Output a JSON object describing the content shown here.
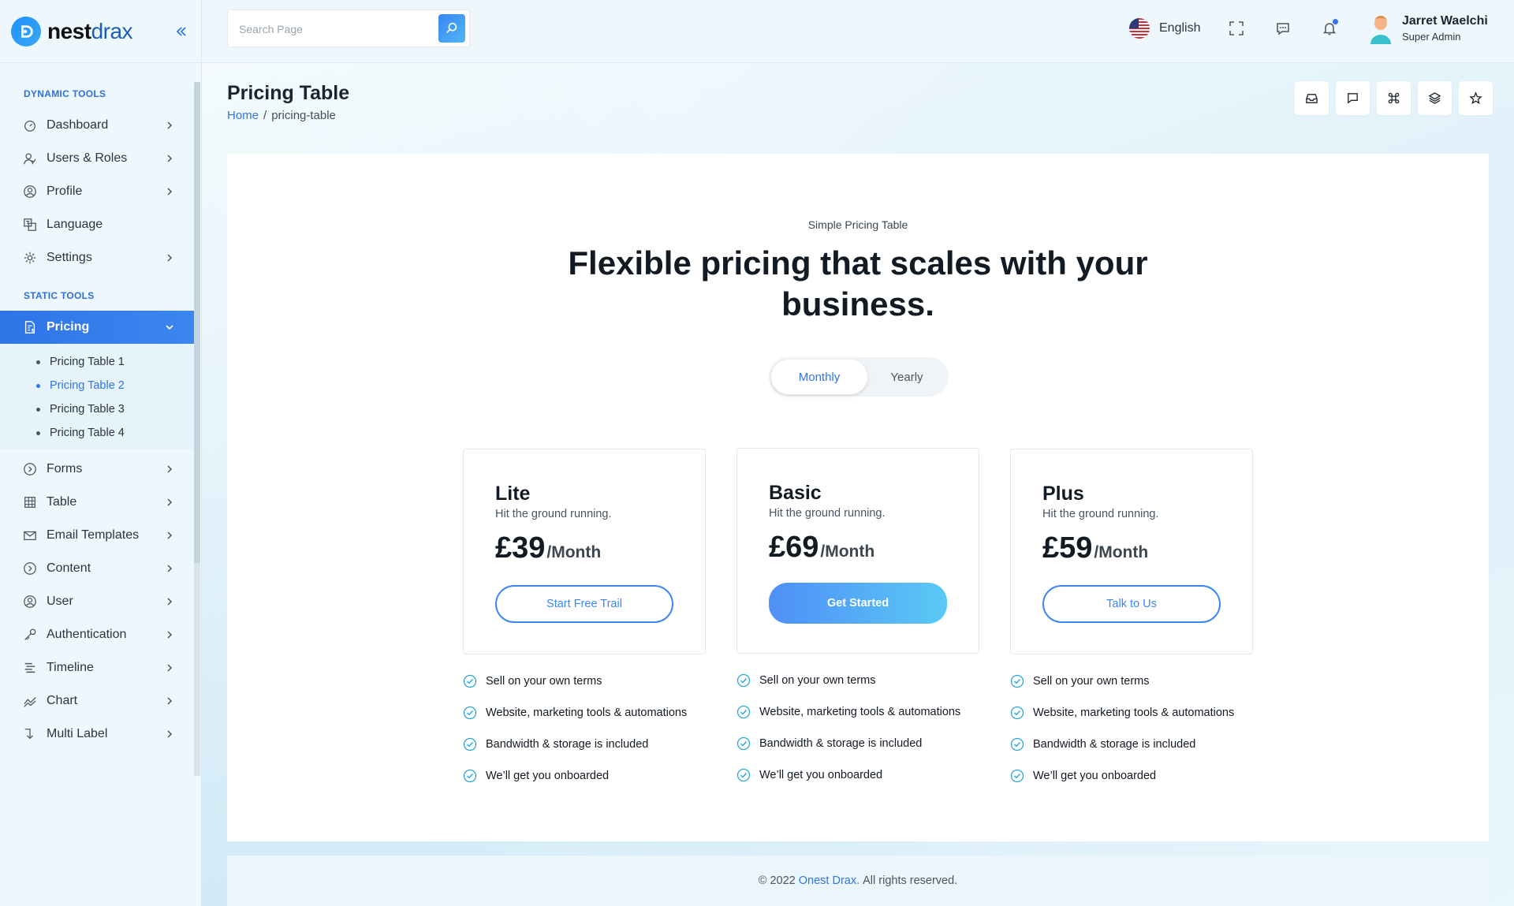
{
  "brand": {
    "part1": "nest",
    "part2": "drax"
  },
  "search": {
    "placeholder": "Search Page"
  },
  "header": {
    "language": "English",
    "user": {
      "name": "Jarret Waelchi",
      "role": "Super Admin"
    }
  },
  "sidebar": {
    "section_dynamic": "DYNAMIC TOOLS",
    "section_static": "STATIC TOOLS",
    "dynamic_items": [
      {
        "label": "Dashboard",
        "icon": "gauge-icon"
      },
      {
        "label": "Users & Roles",
        "icon": "users-icon"
      },
      {
        "label": "Profile",
        "icon": "user-circle-icon"
      },
      {
        "label": "Language",
        "icon": "translate-icon"
      },
      {
        "label": "Settings",
        "icon": "gear-icon"
      }
    ],
    "active_item": {
      "label": "Pricing",
      "icon": "invoice-icon"
    },
    "sub_items": [
      {
        "label": "Pricing Table 1"
      },
      {
        "label": "Pricing Table 2"
      },
      {
        "label": "Pricing Table 3"
      },
      {
        "label": "Pricing Table 4"
      }
    ],
    "static_items": [
      {
        "label": "Forms",
        "icon": "circle-arrow-icon"
      },
      {
        "label": "Table",
        "icon": "grid-icon"
      },
      {
        "label": "Email Templates",
        "icon": "mail-icon"
      },
      {
        "label": "Content",
        "icon": "circle-arrow-icon"
      },
      {
        "label": "User",
        "icon": "user-circle-icon"
      },
      {
        "label": "Authentication",
        "icon": "key-icon"
      },
      {
        "label": "Timeline",
        "icon": "timeline-icon"
      },
      {
        "label": "Chart",
        "icon": "chart-icon"
      },
      {
        "label": "Multi Label",
        "icon": "level-icon"
      }
    ]
  },
  "page": {
    "title": "Pricing Table",
    "breadcrumb_home": "Home",
    "breadcrumb_sep": "/",
    "breadcrumb_current": "pricing-table"
  },
  "pricing": {
    "eyebrow": "Simple Pricing Table",
    "headline": "Flexible pricing that scales with your business.",
    "toggle": {
      "monthly": "Monthly",
      "yearly": "Yearly",
      "selected": "Monthly"
    },
    "plans": [
      {
        "name": "Lite",
        "subtitle": "Hit the ground running.",
        "price": "£39",
        "period": "/Month",
        "button": "Start Free Trail",
        "button_style": "outline",
        "features": [
          "Sell on your own terms",
          "Website, marketing tools & automations",
          "Bandwidth & storage is included",
          "We’ll get you onboarded"
        ]
      },
      {
        "name": "Basic",
        "subtitle": "Hit the ground running.",
        "price": "£69",
        "period": "/Month",
        "button": "Get Started",
        "button_style": "filled",
        "features": [
          "Sell on your own terms",
          "Website, marketing tools & automations",
          "Bandwidth & storage is included",
          "We’ll get you onboarded"
        ]
      },
      {
        "name": "Plus",
        "subtitle": "Hit the ground running.",
        "price": "£59",
        "period": "/Month",
        "button": "Talk to Us",
        "button_style": "outline",
        "features": [
          "Sell on your own terms",
          "Website, marketing tools & automations",
          "Bandwidth & storage is included",
          "We’ll get you onboarded"
        ]
      }
    ]
  },
  "footer": {
    "prefix": "© 2022",
    "brand": "Onest Drax.",
    "suffix": "All rights reserved."
  },
  "colors": {
    "accent": "#2f74e8",
    "button_gradient_start": "#4f8ff6",
    "button_gradient_end": "#5ac9f5",
    "check": "#2aa7d6"
  }
}
